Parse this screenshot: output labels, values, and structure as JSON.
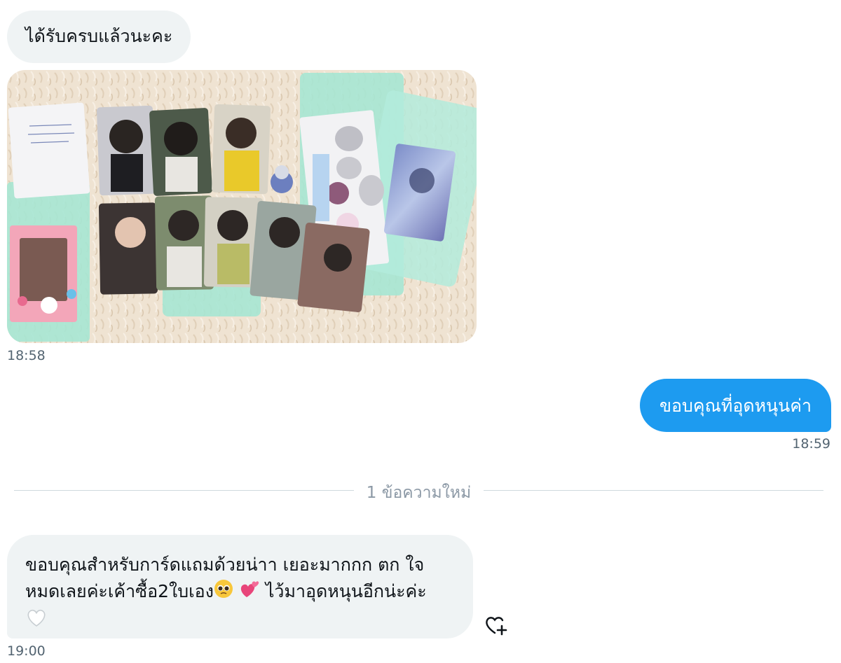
{
  "messages": [
    {
      "id": "m1",
      "direction": "incoming",
      "text": "ได้รับครบแล้วนะคะ"
    },
    {
      "id": "m1-photo",
      "direction": "incoming",
      "type": "photo",
      "time": "18:58"
    },
    {
      "id": "m2",
      "direction": "outgoing",
      "text": "ขอบคุณที่อุดหนุนค่า",
      "time": "18:59"
    },
    {
      "id": "m3",
      "direction": "incoming",
      "line1": "ขอบคุณสำหรับการ์ดแถมด้วยน่าา เยอะมากกก ตก ใจ",
      "line2_a": "หมดเลยค่ะเค้าซื้อ2ใบเอง",
      "line2_b": " ไว้มาอุดหนุนอีกน่ะค่ะ",
      "time": "19:00",
      "emojis": [
        "pleading-face-emoji",
        "revolving-hearts-emoji",
        "white-heart-emoji"
      ]
    }
  ],
  "divider": {
    "label": "1 ข้อความใหม่"
  },
  "icons": {
    "react": "heart-plus-icon"
  },
  "colors": {
    "incoming_bubble": "#eff3f4",
    "outgoing_bubble": "#1d9bf0",
    "time_text": "#536471",
    "divider_line": "#cfd9de",
    "mint_sleeve": "#9fe3cf",
    "fluffy_rug": "#efe3d2"
  }
}
